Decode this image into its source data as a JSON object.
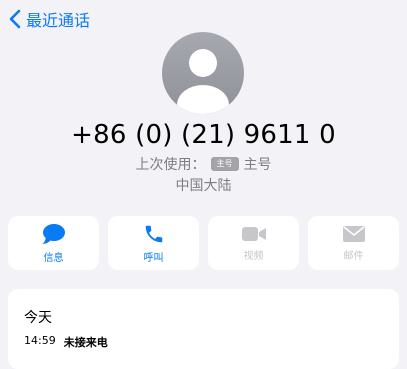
{
  "nav": {
    "back_label": "最近通话"
  },
  "contact": {
    "phone_number": "+86 (0) (21) 9611 0",
    "last_used_label": "上次使用：",
    "sim_badge": "主号",
    "sim_name": "主号",
    "region": "中国大陆"
  },
  "actions": [
    {
      "label": "信息",
      "icon": "message-icon",
      "enabled": true
    },
    {
      "label": "呼叫",
      "icon": "phone-icon",
      "enabled": true
    },
    {
      "label": "视频",
      "icon": "video-icon",
      "enabled": false
    },
    {
      "label": "邮件",
      "icon": "mail-icon",
      "enabled": false
    }
  ],
  "history": {
    "title": "今天",
    "entries": [
      {
        "time": "14:59",
        "status": "未接来电"
      }
    ]
  },
  "colors": {
    "accent": "#0a7af5",
    "disabled": "#c6c6cb",
    "background": "#f2f2f7"
  }
}
